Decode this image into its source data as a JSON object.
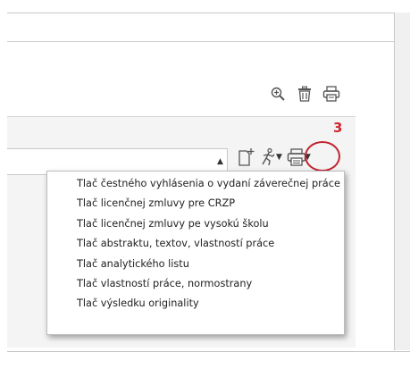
{
  "annotation": {
    "step_number": "3",
    "highlight_color": "#c0242f"
  },
  "top_toolbar": {
    "icons": [
      "zoom-in-icon",
      "trash-icon",
      "printer-icon"
    ]
  },
  "work_toolbar": {
    "icons": [
      "new-document-icon",
      "running-man-icon",
      "printer-icon"
    ]
  },
  "print_menu": {
    "items": [
      "Tlač čestného vyhlásenia o vydaní záverečnej práce",
      "Tlač licenčnej zmluvy pre CRZP",
      "Tlač licenčnej zmluvy pe vysokú školu",
      "Tlač abstraktu, textov, vlastností práce",
      "Tlač analytického listu",
      "Tlač vlastností práce, normostrany",
      "Tlač výsledku originality"
    ]
  }
}
